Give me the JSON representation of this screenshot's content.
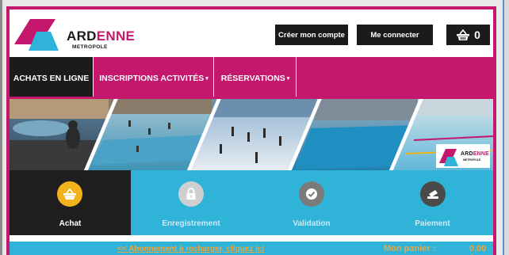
{
  "logo": {
    "word_dark": "ARD",
    "word_accent": "ENNE",
    "subtitle": "METROPOLE"
  },
  "header": {
    "create_account": "Créer mon compte",
    "login": "Me connecter",
    "cart_count": "0"
  },
  "nav": {
    "items": [
      {
        "label": "ACHATS EN LIGNE",
        "active": true,
        "has_dropdown": false
      },
      {
        "label": "INSCRIPTIONS ACTIVITÉS",
        "active": false,
        "has_dropdown": true
      },
      {
        "label": "RÉSERVATIONS",
        "active": false,
        "has_dropdown": true
      }
    ],
    "caret": "▾"
  },
  "banner": {
    "badge_word_dark": "ARD",
    "badge_word_accent": "ENNE",
    "badge_subtitle": "METROPOLE"
  },
  "steps": [
    {
      "label": "Achat",
      "icon": "basket-icon",
      "active": true
    },
    {
      "label": "Enregistrement",
      "icon": "lock-icon",
      "active": false
    },
    {
      "label": "Validation",
      "icon": "check-icon",
      "active": false
    },
    {
      "label": "Paiement",
      "icon": "card-hand-icon",
      "active": false
    }
  ],
  "footer_bar": {
    "abonnement_link": "<< Abonnement à recharger, cliquez ici",
    "panier_label": "Mon panier :",
    "panier_total": "0,00 €"
  },
  "colors": {
    "brand_magenta": "#c4176d",
    "brand_cyan": "#2fb3d9",
    "dark": "#1b1b1b",
    "step_active_circle": "#f2b31c",
    "step_inactive_circle": "#cfcfcf",
    "orange_text": "#f0a53a"
  }
}
